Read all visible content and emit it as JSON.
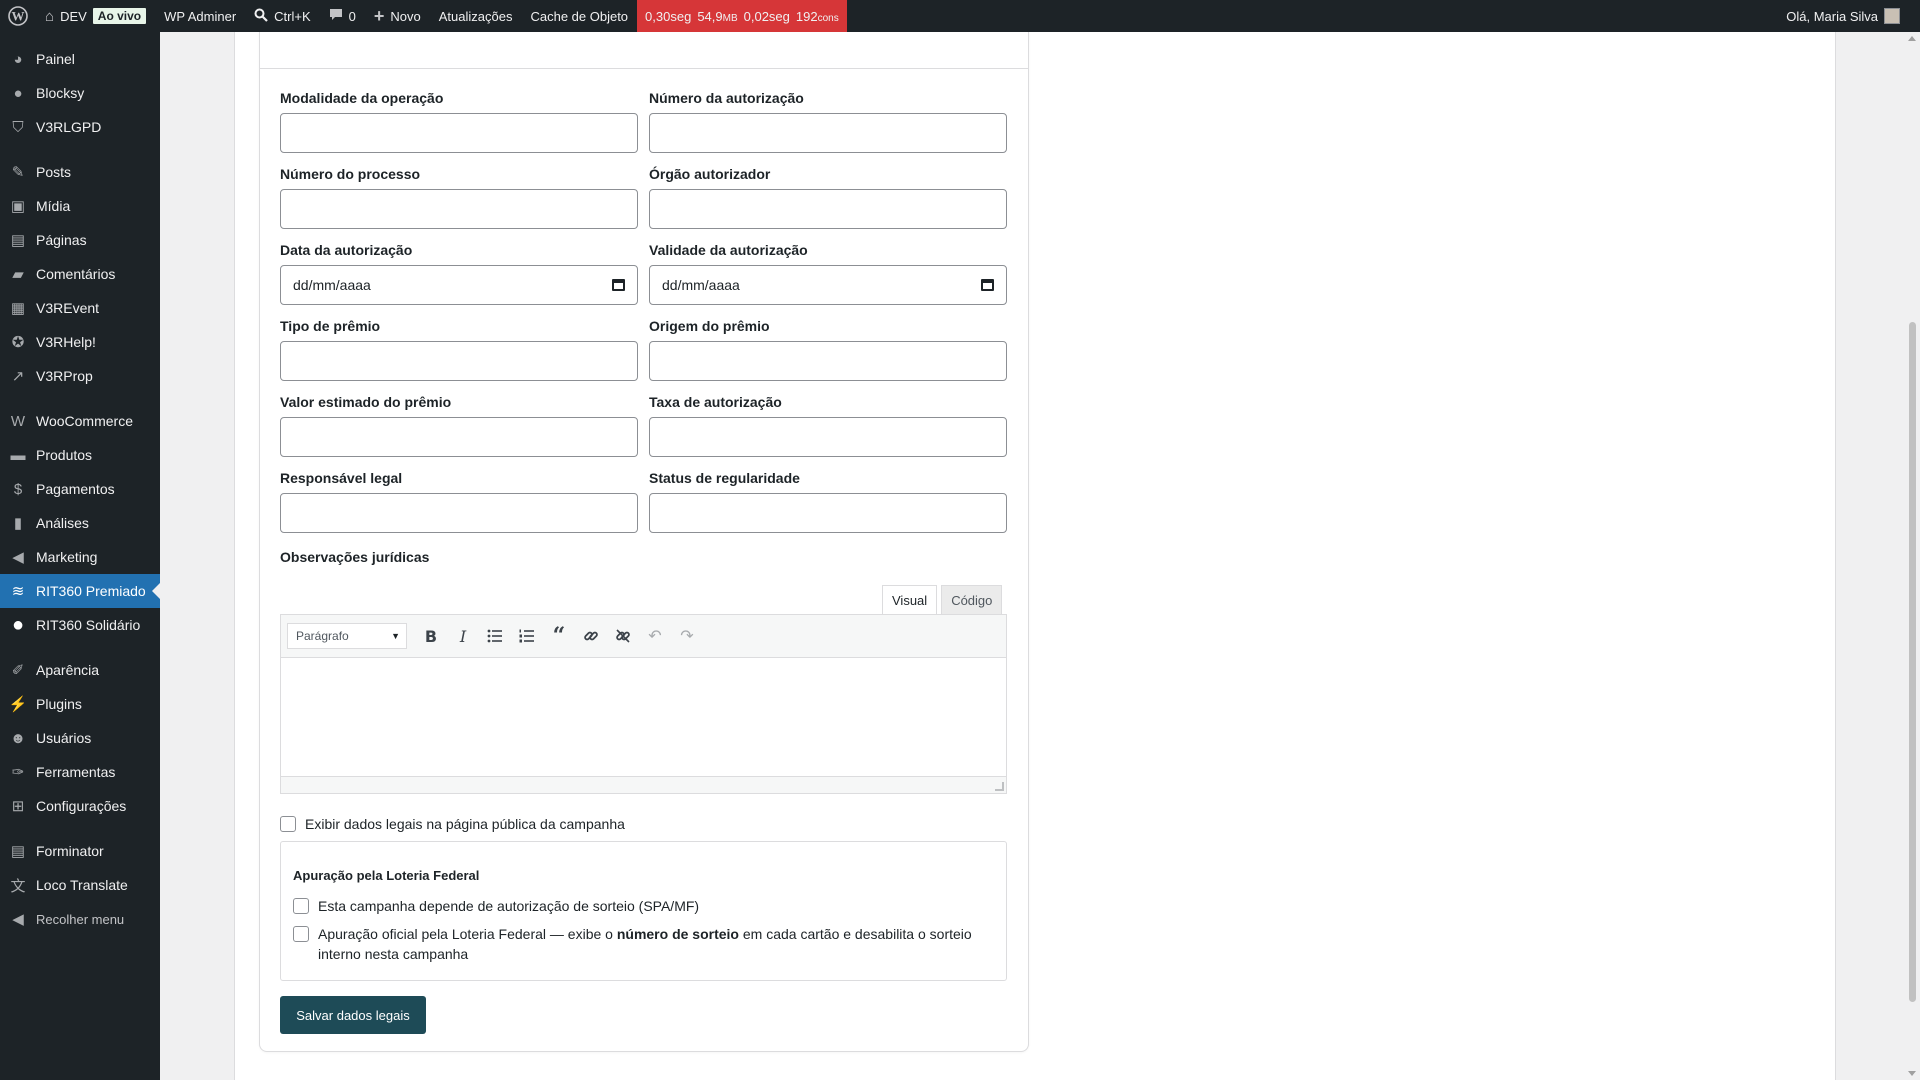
{
  "adminbar": {
    "site_name": "DEV",
    "live_badge": "Ao vivo",
    "adminer": "WP Adminer",
    "search_shortcut": "Ctrl+K",
    "comments_count": "0",
    "new_label": "Novo",
    "updates": "Atualizações",
    "object_cache": "Cache de Objeto",
    "qm_time": "0,30seg",
    "qm_memory": "54,9",
    "qm_memory_unit": "MB",
    "qm_db_time": "0,02seg",
    "qm_queries": "192",
    "qm_queries_unit": "cons",
    "greeting": "Olá, Maria Silva"
  },
  "sidebar": {
    "items": [
      {
        "label": "Painel",
        "icon": "dashboard-icon",
        "glyph": "◕"
      },
      {
        "label": "Blocksy",
        "icon": "blocksy-icon",
        "glyph": "●"
      },
      {
        "label": "V3RLGPD",
        "icon": "shield-icon",
        "glyph": "⛉"
      },
      {
        "label": "Posts",
        "icon": "pin-icon",
        "glyph": "✎"
      },
      {
        "label": "Mídia",
        "icon": "media-icon",
        "glyph": "▣"
      },
      {
        "label": "Páginas",
        "icon": "pages-icon",
        "glyph": "▤"
      },
      {
        "label": "Comentários",
        "icon": "comment-icon",
        "glyph": "▰"
      },
      {
        "label": "V3REvent",
        "icon": "calendar-icon",
        "glyph": "▦"
      },
      {
        "label": "V3RHelp!",
        "icon": "help-icon",
        "glyph": "✪"
      },
      {
        "label": "V3RProp",
        "icon": "chart-line-icon",
        "glyph": "↗"
      },
      {
        "label": "WooCommerce",
        "icon": "woocommerce-icon",
        "glyph": "W"
      },
      {
        "label": "Produtos",
        "icon": "archive-icon",
        "glyph": "▬"
      },
      {
        "label": "Pagamentos",
        "icon": "payment-icon",
        "glyph": "$"
      },
      {
        "label": "Análises",
        "icon": "bar-chart-icon",
        "glyph": "▮"
      },
      {
        "label": "Marketing",
        "icon": "megaphone-icon",
        "glyph": "◀"
      },
      {
        "label": "RIT360 Premiado",
        "icon": "prize-icon",
        "glyph": "≋"
      },
      {
        "label": "RIT360 Solidário",
        "icon": "circle-icon",
        "glyph": "●"
      },
      {
        "label": "Aparência",
        "icon": "brush-icon",
        "glyph": "✐"
      },
      {
        "label": "Plugins",
        "icon": "plugin-icon",
        "glyph": "⚡"
      },
      {
        "label": "Usuários",
        "icon": "user-icon",
        "glyph": "☻"
      },
      {
        "label": "Ferramentas",
        "icon": "wrench-icon",
        "glyph": "✑"
      },
      {
        "label": "Configurações",
        "icon": "settings-icon",
        "glyph": "⊞"
      },
      {
        "label": "Forminator",
        "icon": "form-icon",
        "glyph": "▤"
      },
      {
        "label": "Loco Translate",
        "icon": "translate-icon",
        "glyph": "文"
      }
    ],
    "collapse_label": "Recolher menu"
  },
  "form": {
    "fields": {
      "modalidade": {
        "label": "Modalidade da operação",
        "value": ""
      },
      "numero_autorizacao": {
        "label": "Número da autorização",
        "value": ""
      },
      "numero_processo": {
        "label": "Número do processo",
        "value": ""
      },
      "orgao": {
        "label": "Órgão autorizador",
        "value": ""
      },
      "data_autorizacao": {
        "label": "Data da autorização",
        "value": "dd/mm/aaaa"
      },
      "validade": {
        "label": "Validade da autorização",
        "value": "dd/mm/aaaa"
      },
      "tipo_premio": {
        "label": "Tipo de prêmio",
        "value": ""
      },
      "origem_premio": {
        "label": "Origem do prêmio",
        "value": ""
      },
      "valor_premio": {
        "label": "Valor estimado do prêmio",
        "value": ""
      },
      "taxa": {
        "label": "Taxa de autorização",
        "value": ""
      },
      "responsavel": {
        "label": "Responsável legal",
        "value": ""
      },
      "status": {
        "label": "Status de regularidade",
        "value": ""
      }
    },
    "observacoes_label": "Observações jurídicas",
    "editor": {
      "tab_visual": "Visual",
      "tab_code": "Código",
      "format_value": "Parágrafo"
    },
    "show_public_label": "Exibir dados legais na página pública da campanha",
    "lottery": {
      "title": "Apuração pela Loteria Federal",
      "depends_label": "Esta campanha depende de autorização de sorteio (SPA/MF)",
      "official_pre": "Apuração oficial pela Loteria Federal — exibe o ",
      "official_bold": "número de sorteio",
      "official_post": " em cada cartão e desabilita o sorteio interno nesta campanha"
    },
    "save_label": "Salvar dados legais"
  }
}
